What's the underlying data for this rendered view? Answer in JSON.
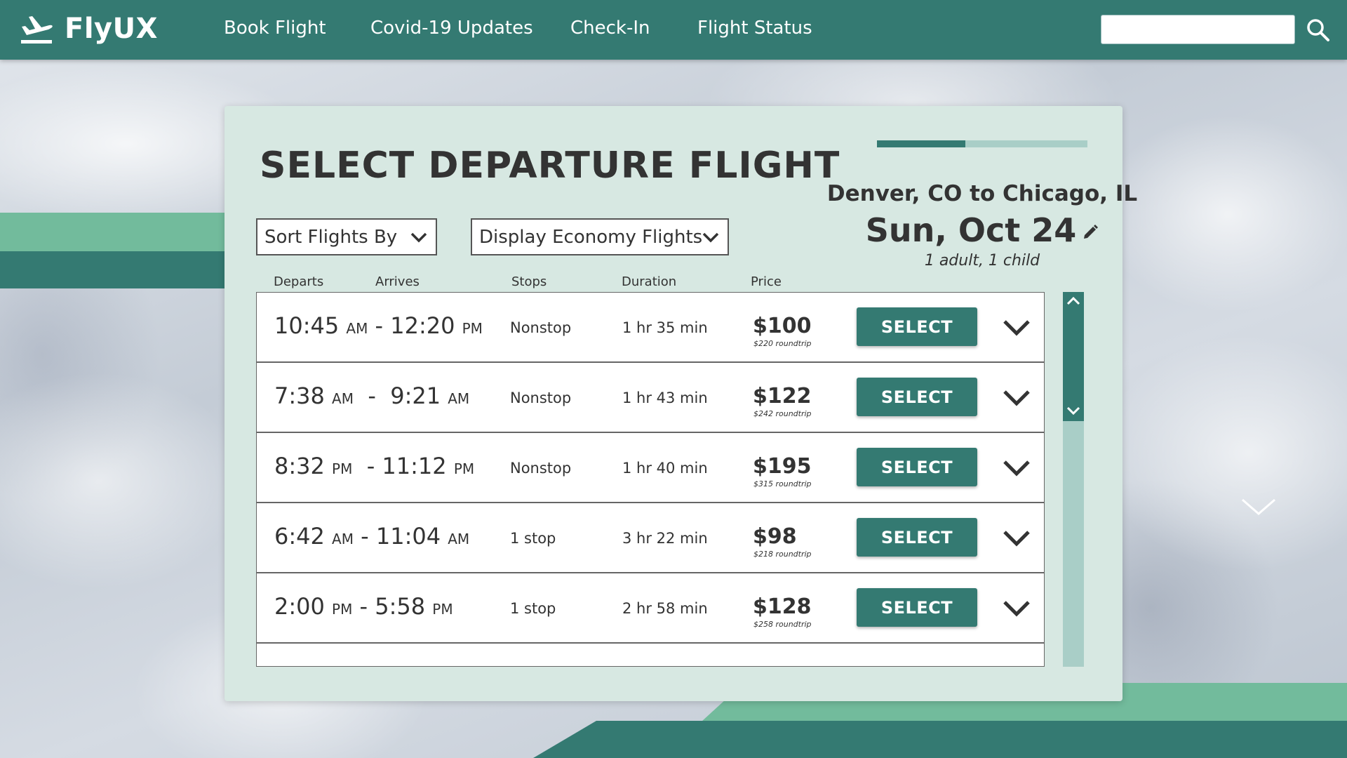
{
  "brand": {
    "name": "FlyUX"
  },
  "nav": {
    "items": [
      {
        "label": "Book Flight"
      },
      {
        "label": "Covid-19 Updates"
      },
      {
        "label": "Check-In"
      },
      {
        "label": "Flight Status"
      }
    ],
    "search": {
      "placeholder": "",
      "value": ""
    }
  },
  "page": {
    "title": "SELECT DEPARTURE FLIGHT",
    "progress_fraction": 0.42,
    "route": "Denver, CO to Chicago, IL",
    "date": "Sun, Oct 24",
    "passengers": "1 adult, 1 child"
  },
  "filters": {
    "sort_label": "Sort Flights By",
    "class_label": "Display Economy Flights"
  },
  "columns": [
    "Departs",
    "Arrives",
    "Stops",
    "Duration",
    "Price"
  ],
  "flights": [
    {
      "dep_time": "10:45",
      "dep_ampm": "AM",
      "arr_time": "12:20",
      "arr_ampm": "PM",
      "stops": "Nonstop",
      "duration": "1 hr 35 min",
      "price": "$100",
      "roundtrip": "$220 roundtrip",
      "button": "SELECT"
    },
    {
      "dep_time": "7:38",
      "dep_ampm": "AM",
      "arr_time": "9:21",
      "arr_ampm": "AM",
      "stops": "Nonstop",
      "duration": "1 hr 43 min",
      "price": "$122",
      "roundtrip": "$242 roundtrip",
      "button": "SELECT"
    },
    {
      "dep_time": "8:32",
      "dep_ampm": "PM",
      "arr_time": "11:12",
      "arr_ampm": "PM",
      "stops": "Nonstop",
      "duration": "1 hr 40 min",
      "price": "$195",
      "roundtrip": "$315 roundtrip",
      "button": "SELECT"
    },
    {
      "dep_time": "6:42",
      "dep_ampm": "AM",
      "arr_time": "11:04",
      "arr_ampm": "AM",
      "stops": "1 stop",
      "duration": "3 hr 22 min",
      "price": "$98",
      "roundtrip": "$218 roundtrip",
      "button": "SELECT"
    },
    {
      "dep_time": "2:00",
      "dep_ampm": "PM",
      "arr_time": "5:58",
      "arr_ampm": "PM",
      "stops": "1 stop",
      "duration": "2 hr 58 min",
      "price": "$128",
      "roundtrip": "$258 roundtrip",
      "button": "SELECT"
    }
  ],
  "icons": {
    "logo": "airplane-takeoff-icon",
    "search": "search-icon",
    "edit": "pencil-icon",
    "dropdown": "chevron-down-icon",
    "expand": "chevron-down-icon",
    "scroll_up": "chevron-up-icon",
    "scroll_down": "chevron-down-icon"
  },
  "colors": {
    "primary": "#347a72",
    "accent_light": "#72bb9c",
    "card_bg": "#d7e8e2",
    "scroll_track": "#a9cec7"
  }
}
